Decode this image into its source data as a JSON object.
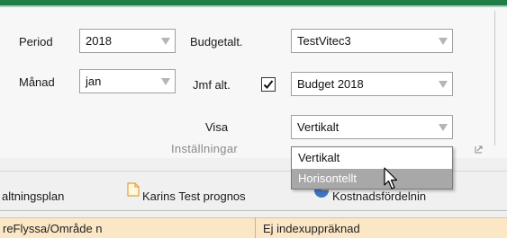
{
  "ribbon": {
    "period": {
      "label": "Period",
      "value": "2018"
    },
    "manad": {
      "label": "Månad",
      "value": "jan"
    },
    "budgetalt": {
      "label": "Budgetalt.",
      "value": "TestVitec3"
    },
    "jmfalt": {
      "label": "Jmf alt.",
      "checked": true,
      "value": "Budget 2018"
    },
    "visa": {
      "label": "Visa",
      "value": "Vertikalt"
    },
    "group_label": "Inställningar"
  },
  "dropdown": {
    "options": [
      "Vertikalt",
      "Horisontellt"
    ],
    "highlighted": "Horisontellt"
  },
  "tabs": [
    {
      "label": "altningsplan"
    },
    {
      "label": "Karins Test prognos",
      "icon": "document-icon"
    },
    {
      "label": "Kostnadsfördelnin",
      "icon": "pie-chart-icon"
    }
  ],
  "grid": {
    "cells": [
      "reFlyssa/Område n",
      "Ej indexuppräknad"
    ]
  },
  "colors": {
    "accent": "#1e7e45",
    "highlight": "#a8a8a8",
    "row": "#fbe7c6"
  }
}
